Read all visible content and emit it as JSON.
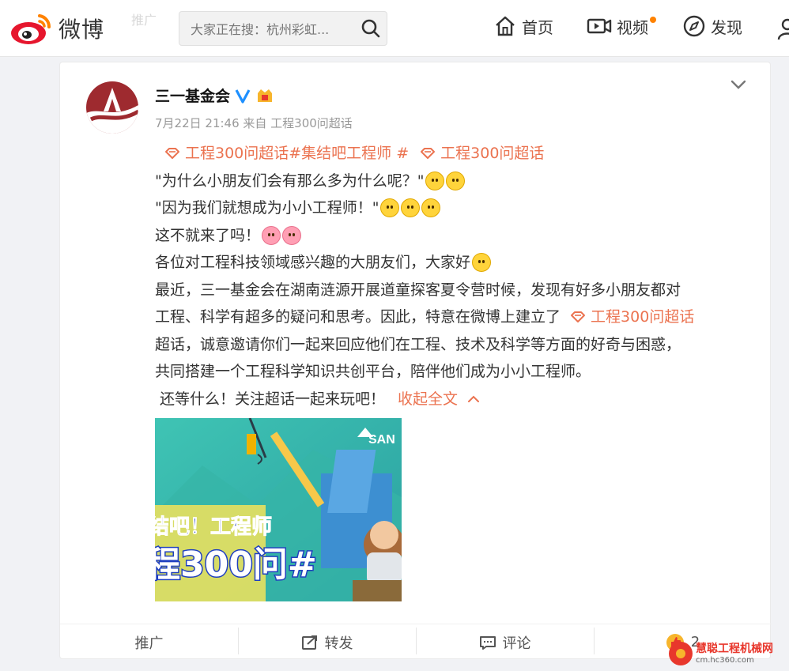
{
  "header": {
    "logo_text": "微博",
    "ghost_tab": "推广",
    "search_placeholder": "大家正在搜：杭州彩虹...",
    "nav": [
      {
        "label": "首页",
        "icon": "home-icon"
      },
      {
        "label": "视频",
        "icon": "video-icon"
      },
      {
        "label": "发现",
        "icon": "compass-icon"
      }
    ]
  },
  "post": {
    "username": "三一基金会",
    "meta": "7月22日 21:46 来自 工程300问超话",
    "topics_line": [
      "工程300问超话#集结吧工程师 #",
      "工程300问超话"
    ],
    "lines": [
      "\"为什么小朋友们会有那么多为什么呢？\"",
      "\"因为我们就想成为小小工程师！\"",
      "这不就来了吗！",
      "各位对工程科技领域感兴趣的大朋友们，大家好",
      "最近，三一基金会在湖南涟源开展道童探客夏令营时候，发现有好多小朋友都对",
      "工程、科学有超多的疑问和思考。因此，特意在微博上建立了",
      "超话，诚意邀请你们一起来回应他们在工程、技术及科学等方面的好奇与困惑，",
      "共同搭建一个工程科学知识共创平台，陪伴他们成为小小工程师。",
      " 还等什么！关注超话一起来玩吧！"
    ],
    "inline_topic": "工程300问超话",
    "collapse_label": "收起全文",
    "image": {
      "brand": "SAN",
      "headline1": "结吧！工程师",
      "headline2": "程300问#"
    }
  },
  "actions": {
    "promote": "推广",
    "repost": "转发",
    "comment": "评论",
    "like_count": "2"
  },
  "watermark": {
    "title": "慧聪工程机械网",
    "url": "cm.hc360.com"
  },
  "colors": {
    "accent": "#eb7350",
    "weibo_red": "#e6162d",
    "verified": "#1e90ff"
  }
}
